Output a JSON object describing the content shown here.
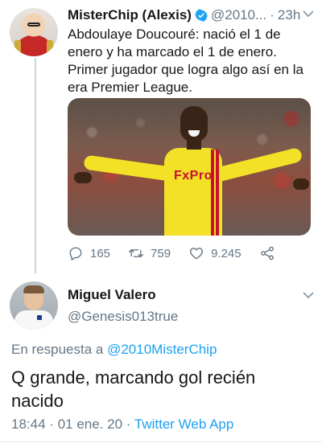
{
  "parent_tweet": {
    "author_name": "MisterChip (Alexis)",
    "handle": "@2010...",
    "separator": "·",
    "time": "23h",
    "text": "Abdoulaye Doucouré: nació el 1 de enero y ha marcado el 1 de enero. Primer jugador que logra algo así en la era Premier League.",
    "photo_sponsor_text": "FxPro",
    "stats": {
      "replies": "165",
      "retweets": "759",
      "likes": "9.245"
    }
  },
  "reply_tweet": {
    "author_name": "Miguel Valero",
    "handle": "@Genesis013true",
    "reply_prefix": "En respuesta a",
    "reply_to_handle": "@2010MisterChip",
    "text": "Q grande, marcando gol recién nacido",
    "time": "18:44",
    "meta_separator": "·",
    "date": "01 ene. 20",
    "source": "Twitter Web App"
  },
  "colors": {
    "link_blue": "#1da1f2",
    "secondary_text": "#657786",
    "primary_text": "#14171a",
    "thread_line": "#ccd6dd",
    "watford_yellow": "#f2e127"
  },
  "icons": [
    "verified-badge-icon",
    "chevron-down-icon",
    "reply-icon",
    "retweet-icon",
    "like-icon",
    "share-icon"
  ]
}
